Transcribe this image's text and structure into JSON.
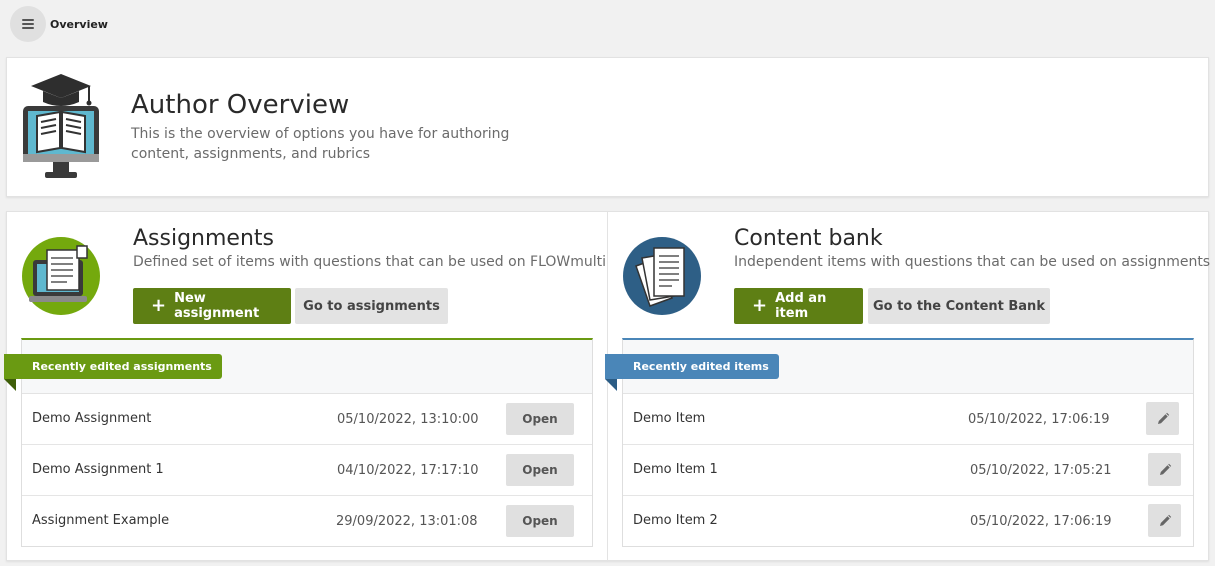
{
  "topbar": {
    "breadcrumb": "Overview"
  },
  "hero": {
    "title": "Author Overview",
    "subtitle": "This is the overview of options you have for authoring content, assignments, and rubrics"
  },
  "assignments": {
    "title": "Assignments",
    "subtitle": "Defined set of items with questions that can be used on FLOWmulti",
    "primary_button": "New assignment",
    "secondary_button": "Go to assignments",
    "list_label": "Recently edited assignments",
    "action_label": "Open",
    "rows": [
      {
        "name": "Demo Assignment",
        "date": "05/10/2022, 13:10:00"
      },
      {
        "name": "Demo Assignment 1",
        "date": "04/10/2022, 17:17:10"
      },
      {
        "name": "Assignment Example",
        "date": "29/09/2022, 13:01:08"
      }
    ]
  },
  "content_bank": {
    "title": "Content bank",
    "subtitle": "Independent items with questions that can be used on assignments",
    "primary_button": "Add an item",
    "secondary_button": "Go to the Content Bank",
    "list_label": "Recently edited items",
    "rows": [
      {
        "name": "Demo Item",
        "date": "05/10/2022, 17:06:19"
      },
      {
        "name": "Demo Item 1",
        "date": "05/10/2022, 17:05:21"
      },
      {
        "name": "Demo Item 2",
        "date": "05/10/2022, 17:06:19"
      }
    ]
  },
  "colors": {
    "primary_green": "#5e7f14",
    "ribbon_green": "#6a9a12",
    "ribbon_blue": "#4a86b8",
    "secondary_grey": "#e3e3e3"
  },
  "icons": {
    "menu": "hamburger-icon",
    "hero": "computer-graduation-book-icon",
    "assignments": "laptop-document-icon",
    "content_bank": "stacked-papers-icon",
    "edit": "pencil-icon",
    "add": "plus-icon"
  }
}
